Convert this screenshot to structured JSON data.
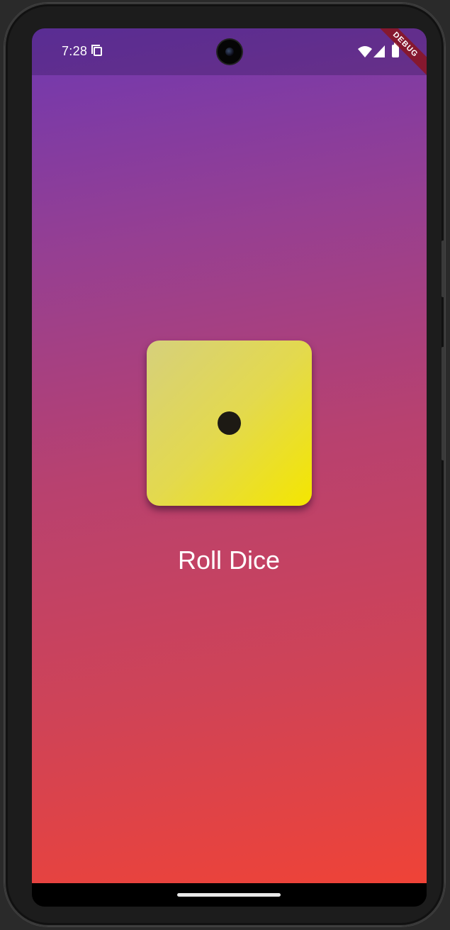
{
  "status_bar": {
    "time": "7:28",
    "icons": [
      "sim-card-icon",
      "wifi-icon",
      "signal-icon",
      "battery-icon"
    ]
  },
  "debug_banner": {
    "label": "DEBUG"
  },
  "dice": {
    "face_value": 1,
    "pip_icon": "dice-pip-icon"
  },
  "roll_button": {
    "label": "Roll Dice"
  },
  "colors": {
    "gradient_top": "#6f38b1",
    "gradient_bottom": "#ef4337",
    "dice_light": "#d6d07c",
    "dice_dark": "#f4e600",
    "pip": "#1d1a14"
  }
}
